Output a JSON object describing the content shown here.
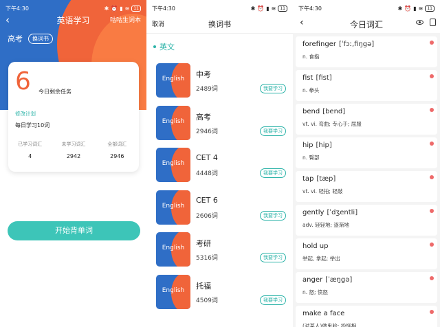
{
  "status_bar": {
    "time": "下午4:30",
    "battery": "11"
  },
  "screen1": {
    "title": "英语学习",
    "glossary_link": "咕咕生词本",
    "current_book": "高考",
    "switch_book_label": "换词书",
    "remaining_count": "6",
    "remaining_label": "今日剩余任务",
    "modify_plan": "修改计划",
    "daily_plan": "每日学习10词",
    "stats": [
      {
        "label": "已学习词汇",
        "value": "4"
      },
      {
        "label": "未学习词汇",
        "value": "2942"
      },
      {
        "label": "全部词汇",
        "value": "2946"
      }
    ],
    "start_button": "开始背单词"
  },
  "screen2": {
    "cancel": "取消",
    "title": "换词书",
    "section": "英文",
    "cover_text": "English",
    "learn_label": "我要学习",
    "books": [
      {
        "name": "中考",
        "count": "2489词"
      },
      {
        "name": "高考",
        "count": "2946词"
      },
      {
        "name": "CET 4",
        "count": "4448词"
      },
      {
        "name": "CET 6",
        "count": "2606词"
      },
      {
        "name": "考研",
        "count": "5316词"
      },
      {
        "name": "托福",
        "count": "4509词"
      }
    ]
  },
  "screen3": {
    "title": "今日词汇",
    "words": [
      {
        "term": "forefinger",
        "phonetic": "[ˈfɔː,fiŋgə]",
        "meaning": "n. 食指"
      },
      {
        "term": "fist",
        "phonetic": "[fist]",
        "meaning": "n. 拳头"
      },
      {
        "term": "bend",
        "phonetic": "[bend]",
        "meaning": "vt. vi. 弯曲; 专心于; 屈服"
      },
      {
        "term": "hip",
        "phonetic": "[hip]",
        "meaning": "n. 臀部"
      },
      {
        "term": "tap",
        "phonetic": "[tæp]",
        "meaning": "vt. vi. 轻拍; 轻敲"
      },
      {
        "term": "gently",
        "phonetic": "[ˈdʒentli]",
        "meaning": "adv. 轻轻地; 逐渐地"
      },
      {
        "term": "hold up",
        "phonetic": "",
        "meaning": "举起, 拿起; 举出"
      },
      {
        "term": "anger",
        "phonetic": "[ˈæŋgə]",
        "meaning": "n. 怒; 愤怒"
      },
      {
        "term": "make a face",
        "phonetic": "",
        "meaning": "(对某人)做鬼脸; 扮怪相"
      }
    ]
  },
  "colors": {
    "accent": "#2bb3a8",
    "orange": "#f0643a",
    "blue": "#2f6ec6",
    "dot": "#ee6a6a"
  }
}
